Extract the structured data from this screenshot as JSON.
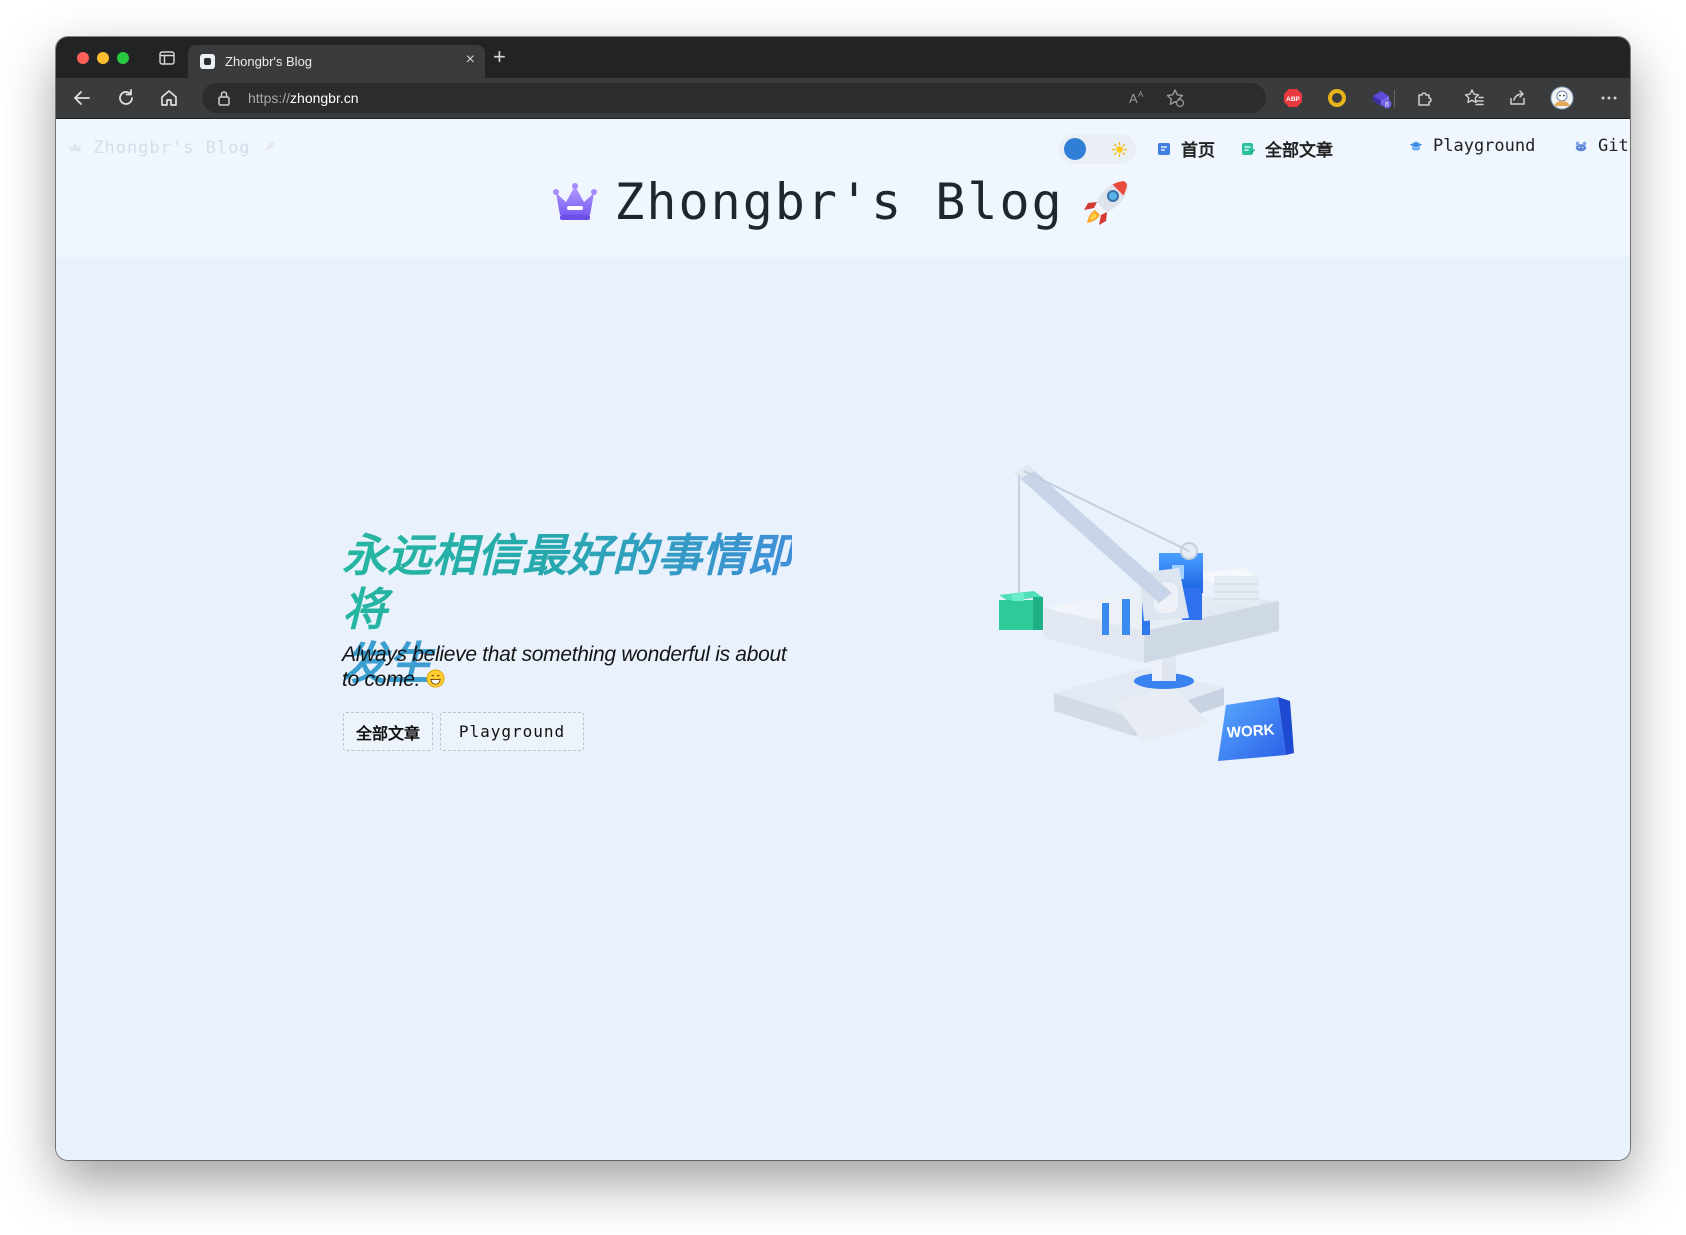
{
  "browser": {
    "tab_title": "Zhongbr's Blog",
    "url_scheme": "https://",
    "url_host": "zhongbr.cn",
    "extension_badge": "8",
    "colors": {
      "chrome_dark": "#222325",
      "toolbar": "#3a3b3d",
      "urlbar": "#2b2c2e"
    }
  },
  "header": {
    "ghost_title": "Zhongbr's Blog",
    "site_title": "Zhongbr's Blog",
    "nav": [
      {
        "label": "首页",
        "icon": "document-icon"
      },
      {
        "label": "全部文章",
        "icon": "article-list-icon"
      },
      {
        "label": "Playground",
        "icon": "graduation-cap-icon"
      },
      {
        "label": "Github",
        "icon": "github-icon"
      }
    ],
    "theme_toggle": {
      "icon": "sun-icon",
      "mode": "light"
    }
  },
  "hero": {
    "tagline_line1": "永远相信最好的事情即将",
    "tagline_line2": "发生",
    "subtitle": "Always believe that something wonderful is about to come.",
    "buttons": [
      "全部文章",
      "Playground"
    ],
    "illustration_label": "WORK",
    "gradient": [
      "#25b7a0",
      "#3f8fd8"
    ]
  },
  "page": {
    "background": "#e9f1fc",
    "accent": "#2f7fd6"
  }
}
